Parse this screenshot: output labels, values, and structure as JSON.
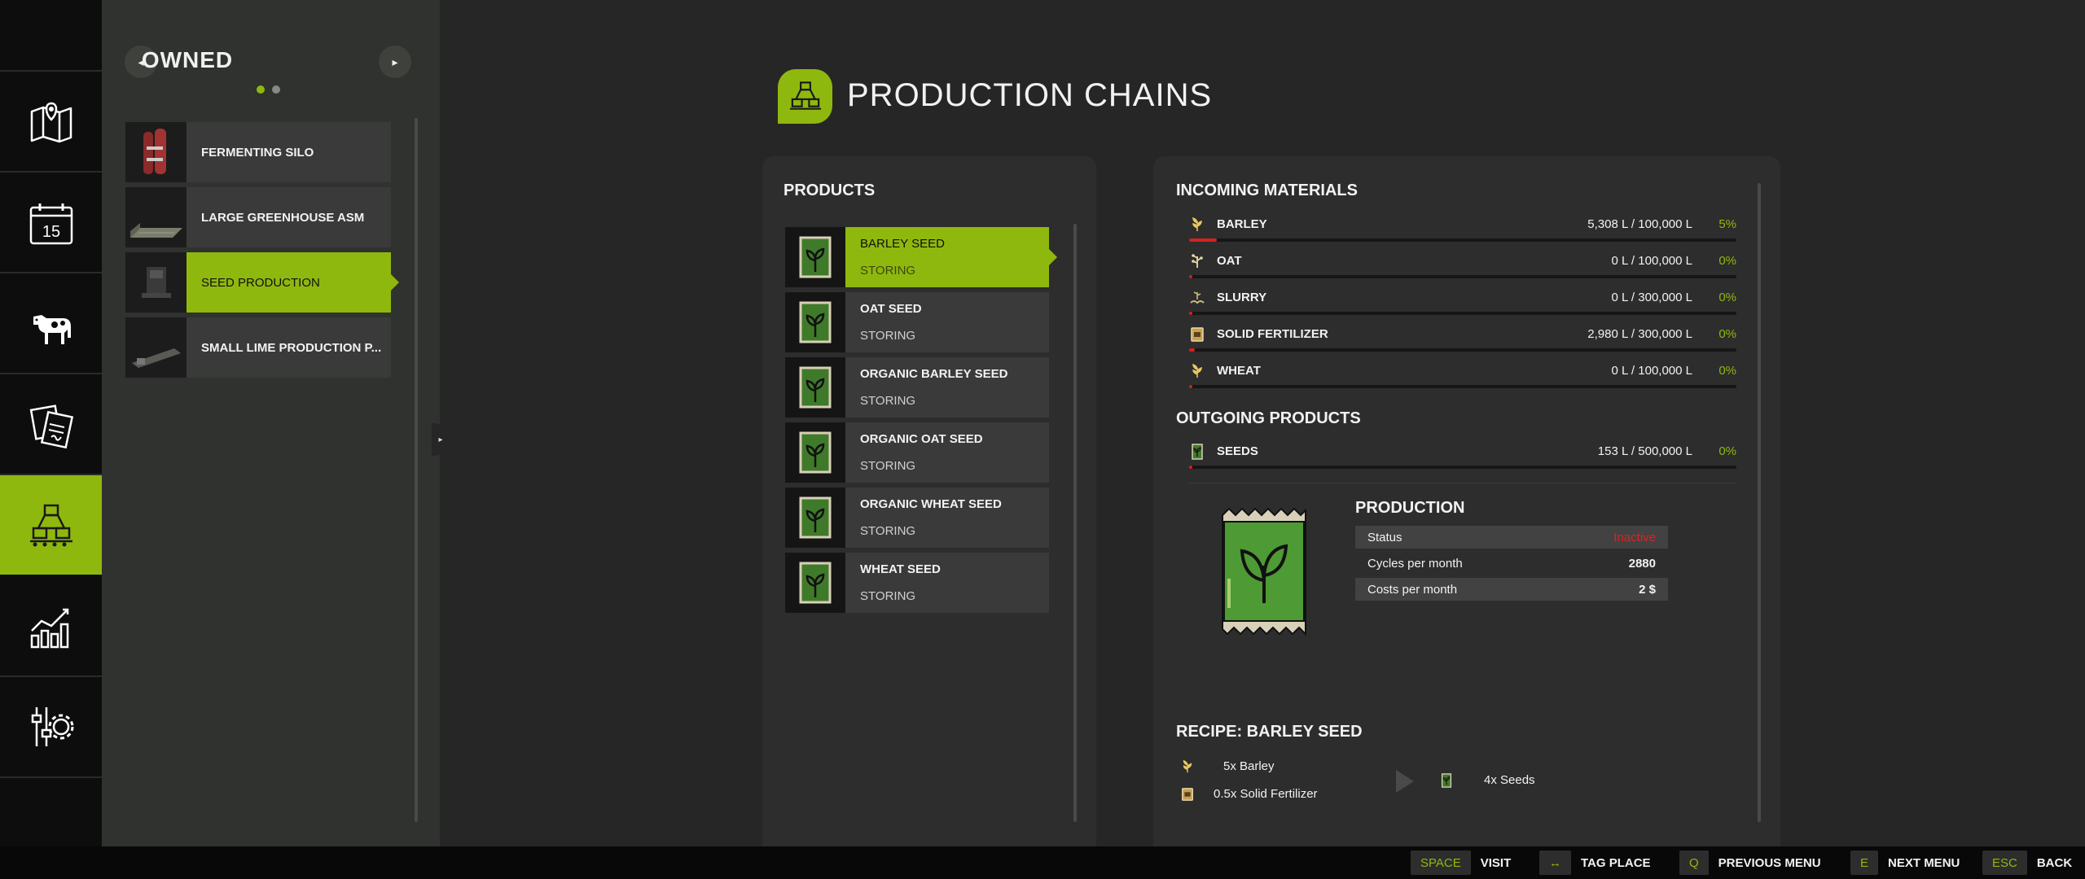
{
  "colors": {
    "accent": "#8fb80e",
    "warning": "#d42020",
    "background": "#262626"
  },
  "rail": {
    "items": [
      {
        "icon": "map-icon"
      },
      {
        "icon": "calendar-icon",
        "day": "15"
      },
      {
        "icon": "cow-icon"
      },
      {
        "icon": "contracts-icon"
      },
      {
        "icon": "production-icon"
      },
      {
        "icon": "statistics-icon"
      },
      {
        "icon": "settings-icon"
      }
    ],
    "active_index": 4
  },
  "owned": {
    "title": "OWNED",
    "prev_label": "◂",
    "next_label": "▸",
    "items": [
      {
        "label": "FERMENTING SILO"
      },
      {
        "label": "LARGE GREENHOUSE ASM"
      },
      {
        "label": "SEED PRODUCTION"
      },
      {
        "label": "SMALL LIME PRODUCTION P..."
      }
    ],
    "active_index": 2
  },
  "header": {
    "title": "PRODUCTION CHAINS"
  },
  "products": {
    "title": "PRODUCTS",
    "items": [
      {
        "name": "BARLEY SEED",
        "status": "STORING"
      },
      {
        "name": "OAT SEED",
        "status": "STORING"
      },
      {
        "name": "ORGANIC BARLEY SEED",
        "status": "STORING"
      },
      {
        "name": "ORGANIC OAT SEED",
        "status": "STORING"
      },
      {
        "name": "ORGANIC WHEAT SEED",
        "status": "STORING"
      },
      {
        "name": "WHEAT SEED",
        "status": "STORING"
      }
    ],
    "active_index": 0
  },
  "incoming": {
    "title": "INCOMING MATERIALS",
    "items": [
      {
        "name": "BARLEY",
        "amount": "5,308 L / 100,000 L",
        "percent": "5%",
        "fill": 0.05
      },
      {
        "name": "OAT",
        "amount": "0 L / 100,000 L",
        "percent": "0%",
        "fill": 0
      },
      {
        "name": "SLURRY",
        "amount": "0 L / 300,000 L",
        "percent": "0%",
        "fill": 0
      },
      {
        "name": "SOLID FERTILIZER",
        "amount": "2,980 L / 300,000 L",
        "percent": "0%",
        "fill": 0.01
      },
      {
        "name": "WHEAT",
        "amount": "0 L / 100,000 L",
        "percent": "0%",
        "fill": 0
      }
    ]
  },
  "outgoing": {
    "title": "OUTGOING PRODUCTS",
    "items": [
      {
        "name": "SEEDS",
        "amount": "153 L / 500,000 L",
        "percent": "0%",
        "fill": 0.0003
      }
    ]
  },
  "production": {
    "title": "PRODUCTION",
    "rows": [
      {
        "label": "Status",
        "value": "Inactive"
      },
      {
        "label": "Cycles per month",
        "value": "2880"
      },
      {
        "label": "Costs per month",
        "value": "2 $"
      }
    ]
  },
  "recipe": {
    "title": "RECIPE: BARLEY SEED",
    "inputs": [
      {
        "text": "5x Barley",
        "icon": "barley-icon"
      },
      {
        "text": "0.5x Solid Fertilizer",
        "icon": "fertilizer-icon"
      }
    ],
    "outputs": [
      {
        "text": "4x Seeds",
        "icon": "seeds-icon"
      }
    ]
  },
  "bottom_bar": {
    "hints": [
      {
        "key": "SPACE",
        "label": "VISIT"
      },
      {
        "key": "↔",
        "label": "TAG PLACE"
      },
      {
        "key": "Q",
        "label": "PREVIOUS MENU"
      },
      {
        "key": "E",
        "label": "NEXT MENU"
      },
      {
        "key": "ESC",
        "label": "BACK"
      }
    ]
  }
}
